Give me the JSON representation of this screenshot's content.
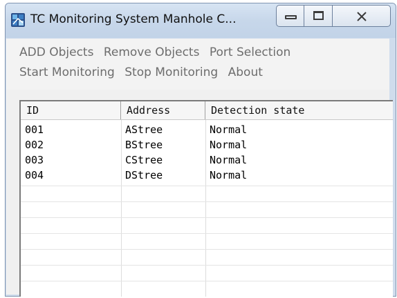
{
  "window": {
    "title": "TC Monitoring System Manhole C...",
    "accent_color": "#cfdcec"
  },
  "title_controls": {
    "minimize_icon": "minimize-icon",
    "maximize_icon": "maximize-icon",
    "close_icon": "close-icon"
  },
  "menu": {
    "row1": [
      "ADD  Objects",
      "Remove Objects",
      "Port Selection"
    ],
    "row2": [
      "Start Monitoring",
      "Stop Monitoring",
      "About"
    ]
  },
  "table": {
    "columns": [
      "ID",
      "Address",
      "Detection state"
    ],
    "rows": [
      {
        "id": "001",
        "address": "AStree",
        "state": "Normal"
      },
      {
        "id": "002",
        "address": "BStree",
        "state": "Normal"
      },
      {
        "id": "003",
        "address": "CStree",
        "state": "Normal"
      },
      {
        "id": "004",
        "address": "DStree",
        "state": "Normal"
      }
    ]
  }
}
